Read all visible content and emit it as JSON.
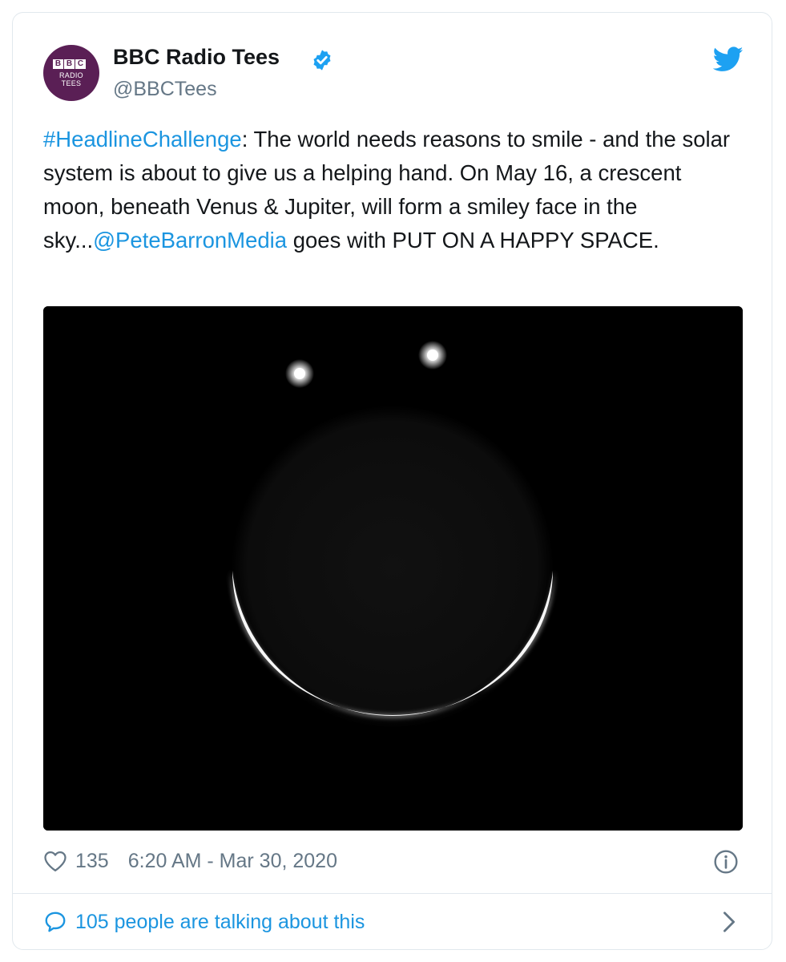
{
  "account": {
    "avatar_logo_letters": [
      "B",
      "B",
      "C"
    ],
    "avatar_line1": "RADIO",
    "avatar_line2": "TEES",
    "name": "BBC Radio Tees",
    "handle": "@BBCTees",
    "verified": true
  },
  "tweet": {
    "hashtag": "#HeadlineChallenge",
    "text_part1": ": The world needs reasons to smile - and the solar system is about to give us a helping hand. On May 16, a crescent moon, beneath Venus & Jupiter, will form a smiley face in the sky...",
    "mention": "@PeteBarronMedia",
    "text_part2": " goes with PUT ON A HAPPY SPACE."
  },
  "footer": {
    "likes": "135",
    "timestamp": "6:20 AM - Mar 30, 2020",
    "conversation": "105 people are talking about this"
  },
  "icons": {
    "bird": "twitter-bird-icon",
    "verified": "verified-badge-icon",
    "heart": "heart-icon",
    "info": "info-icon",
    "conversation": "speech-bubble-icon",
    "chevron": "chevron-right-icon"
  },
  "colors": {
    "link": "#1b95e0",
    "twitter_blue": "#1da1f2",
    "text": "#14171a",
    "muted": "#657786",
    "avatar_bg": "#5a1f55"
  }
}
